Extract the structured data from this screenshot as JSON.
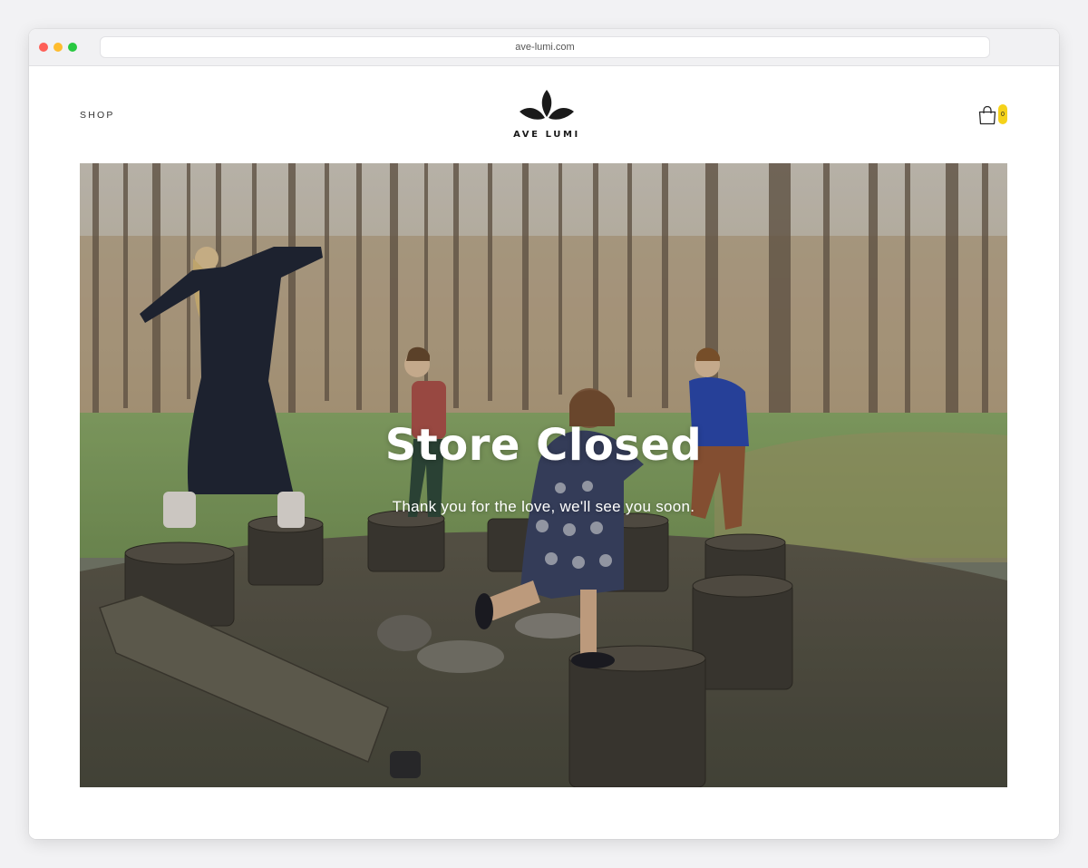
{
  "browser": {
    "url": "ave-lumi.com"
  },
  "header": {
    "nav_shop_label": "SHOP",
    "logo_text": "AVE LUMI",
    "logo_icon": "three-leaf-logo",
    "cart_icon": "shopping-bag-icon",
    "cart_count": "0",
    "cart_badge_color": "#f5d21a"
  },
  "hero": {
    "title": "Store Closed",
    "subtitle": "Thank you for the love, we'll see you soon."
  }
}
